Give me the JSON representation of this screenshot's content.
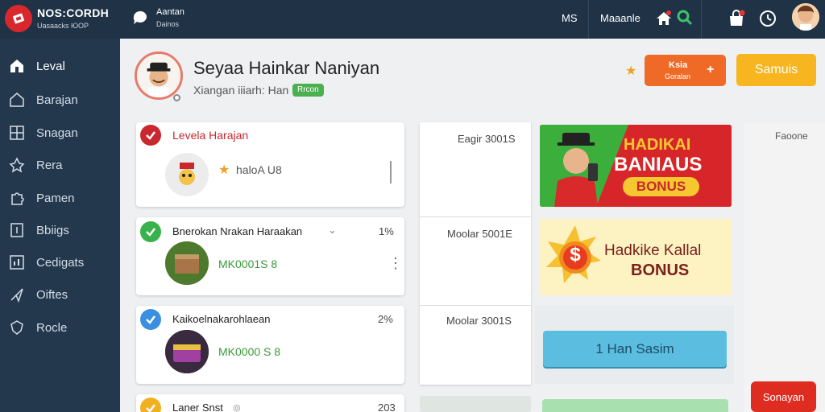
{
  "topbar": {
    "brand": "NOS:CORDH",
    "brand_sub": "Uasaacks ЮОР",
    "user_name": "Aantan",
    "user_sub": "Dainos",
    "ms_label": "MS",
    "nav_label": "Maaanle"
  },
  "sidebar": {
    "items": [
      {
        "label": "Leval",
        "icon": "home-icon"
      },
      {
        "label": "Barajan",
        "icon": "house-outline-icon"
      },
      {
        "label": "Snagan",
        "icon": "grid-icon"
      },
      {
        "label": "Rera",
        "icon": "pin-icon"
      },
      {
        "label": "Pamen",
        "icon": "puzzle-icon"
      },
      {
        "label": "Bbiigs",
        "icon": "document-icon"
      },
      {
        "label": "Cedigats",
        "icon": "chart-icon"
      },
      {
        "label": "Oiftes",
        "icon": "send-icon"
      },
      {
        "label": "Rocle",
        "icon": "shield-icon"
      }
    ]
  },
  "header": {
    "title": "Seyaa Hainkar Naniyan",
    "subtitle": "Xiangan iiiarh: Han",
    "badge": "Rrcon",
    "orange_button_top": "Ksia",
    "orange_button_bottom": "Goralan",
    "orange_button_plus": "+",
    "yellow_button": "Samuis"
  },
  "levels": [
    {
      "title": "Levela Harajan",
      "value": "haloA U8",
      "check_color": "#c8282e",
      "title_color": "#c8282e"
    },
    {
      "title": "Bnerokan Nrakan Haraakan",
      "value": "MK0001S 8",
      "percent": "1%",
      "check_color": "#38b24a",
      "title_color": "#222222",
      "chevron": "⌄"
    },
    {
      "title": "Kaikoelnakarohlaean",
      "value": "MK0000 S 8",
      "percent": "2%",
      "check_color": "#3a8fe0",
      "title_color": "#222222"
    },
    {
      "title": "Laner Snst",
      "percent": "203",
      "check_color": "#f0b020",
      "title_color": "#222222"
    }
  ],
  "middle": {
    "labels": [
      "Eagir 3001S",
      "Moolar 5001E",
      "Moolar 3001S"
    ]
  },
  "banners": {
    "banner1_line1": "HADIKAI",
    "banner1_line2": "BANIAUS",
    "banner1_line3": "BONUS",
    "banner2_line1": "Hadkike Kallal",
    "banner2_line2": "BONUS",
    "banner2_coin": "$"
  },
  "right": {
    "label": "Faoone"
  },
  "buttons": {
    "blue": "1 Han Sasim",
    "red": "Sonayan"
  }
}
